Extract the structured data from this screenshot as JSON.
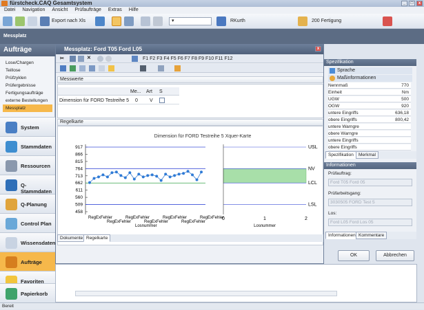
{
  "window": {
    "title": "fürstcheck.CAQ Gesamtsystem"
  },
  "menu": [
    "Datei",
    "Navigation",
    "Ansicht",
    "Prüfaufträge",
    "Extras",
    "Hilfe"
  ],
  "toolbar": {
    "export_label": "Export nach Xls",
    "user": "RKurth",
    "dept": "200 Fertigung"
  },
  "banner": {
    "title": "Messplatz"
  },
  "left": {
    "header": "Aufträge",
    "items": [
      "Lose/Chargen",
      "Teillose",
      "Prüfzyklen",
      "Prüfergebnisse",
      "Fertigungsaufträge",
      "externe Bestellungen",
      "Messplatz"
    ],
    "big": [
      "System",
      "Stammdaten",
      "Ressourcen",
      "Q-Stammdaten",
      "Q-Planung",
      "Control Plan",
      "Wissensdaten",
      "Aufträge",
      "Favoriten",
      "Papierkorb"
    ]
  },
  "mp": {
    "title": "Messplatz: Ford T05 Ford L05",
    "fkeys": "F1 F2 F3 F4 F5 F6 F7 F8 F9 F10 F11 F12",
    "messwerte": "Messwerte",
    "cols": [
      "Me...",
      "Art",
      "S"
    ],
    "row": {
      "name": "Dimension für FORD Testreihe 5",
      "me": "0",
      "art": "V"
    },
    "regelkarte": "Regelkarte",
    "chart_title": "Dimension für FORD Testreihe 5  Xquer-Karte",
    "tabs": [
      "Dokumente",
      "Regelkarte"
    ]
  },
  "chart_data": {
    "type": "line",
    "title": "Dimension für FORD Testreihe 5  Xquer-Karte",
    "yticks": [
      917,
      866,
      815,
      764,
      713,
      662,
      611,
      560,
      509,
      458
    ],
    "ylim": [
      458,
      917
    ],
    "usl": 917,
    "nv": 764,
    "lcl": 662,
    "lsl": 509,
    "ucl": 764,
    "values": [
      665,
      695,
      705,
      720,
      705,
      735,
      740,
      715,
      700,
      735,
      690,
      725,
      705,
      715,
      720,
      710,
      680,
      725,
      705,
      715,
      725,
      730,
      745,
      720,
      685,
      740
    ],
    "xlabels": [
      "RegExFehler",
      "RegExFehler",
      "RegExFehler",
      "RegExFehler",
      "RegExFehler",
      "RegExFehler",
      "RegExFehler"
    ],
    "xlabel_left": "Losnummer",
    "limit_labels": [
      "USL",
      "NV",
      "LCL",
      "LSL"
    ],
    "hist_xticks": [
      "0",
      "1",
      "2"
    ],
    "hist_xlabel": "Losnummer",
    "legend": "none"
  },
  "spec": {
    "header": "Spezifikation",
    "sprache": "Sprache",
    "mass": "Maßinformationen",
    "rows": [
      [
        "Nennmaß",
        "770"
      ],
      [
        "Einheit",
        "Nm"
      ],
      [
        "UGW",
        "500"
      ],
      [
        "OGW",
        "920"
      ],
      [
        "untere Eingriffs",
        "636,18"
      ],
      [
        "obere Eingriffs",
        "800,42"
      ],
      [
        "untere Warngre",
        ""
      ],
      [
        "obere Warngre",
        ""
      ],
      [
        "untere Eingriffs",
        ""
      ],
      [
        "obere Eingriffs",
        ""
      ]
    ],
    "tabs": [
      "Spezifikation",
      "Merkmal"
    ]
  },
  "info": {
    "header": "Informationen",
    "l1": "Prüfauftrag:",
    "v1": "Ford T05 Ford 05",
    "l2": "Prüfarbeitsgang:",
    "v2": "3030505 FORD Test 5",
    "l3": "Los:",
    "v3": "Ford L05 Ford Los 05",
    "tabs": [
      "Informationen",
      "Kommentare"
    ]
  },
  "buttons": {
    "ok": "OK",
    "cancel": "Abbrechen"
  },
  "status": {
    "text": "Bereit"
  }
}
